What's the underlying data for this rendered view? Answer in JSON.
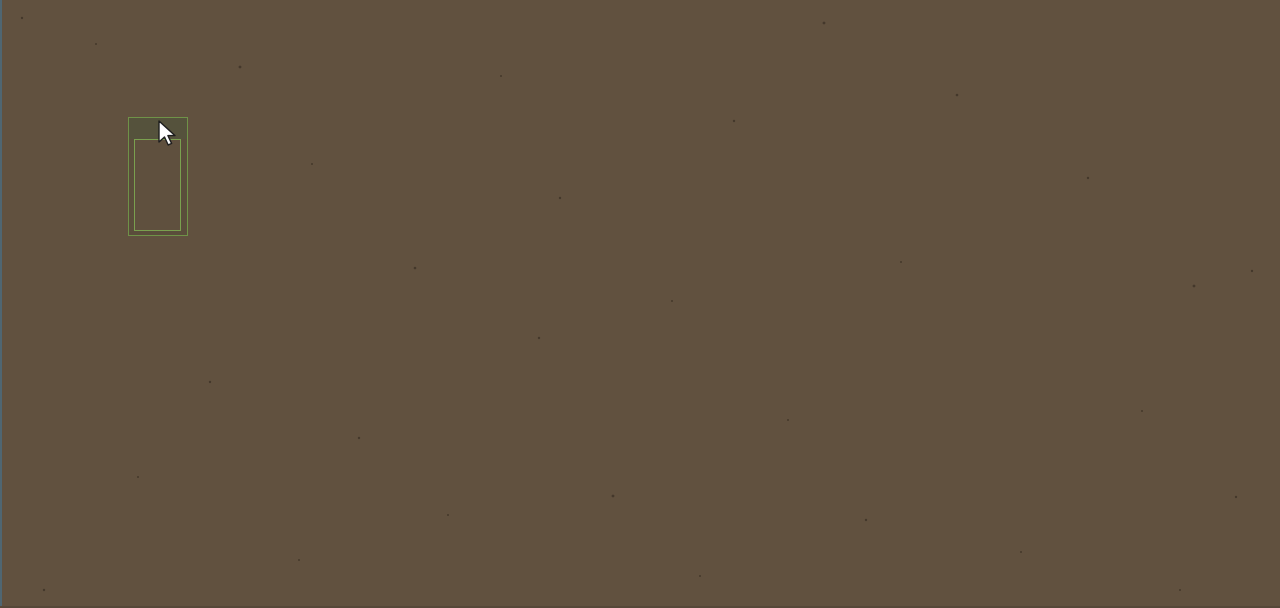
{
  "scene": {
    "background": "#61513f",
    "accent_edge": "#4f6672"
  },
  "widget": {
    "border_color": "#6f9248",
    "inner_border_color": "#7aa04f",
    "header_color": "#55523c"
  },
  "cursor": {
    "icon": "pointer-arrow-icon"
  }
}
